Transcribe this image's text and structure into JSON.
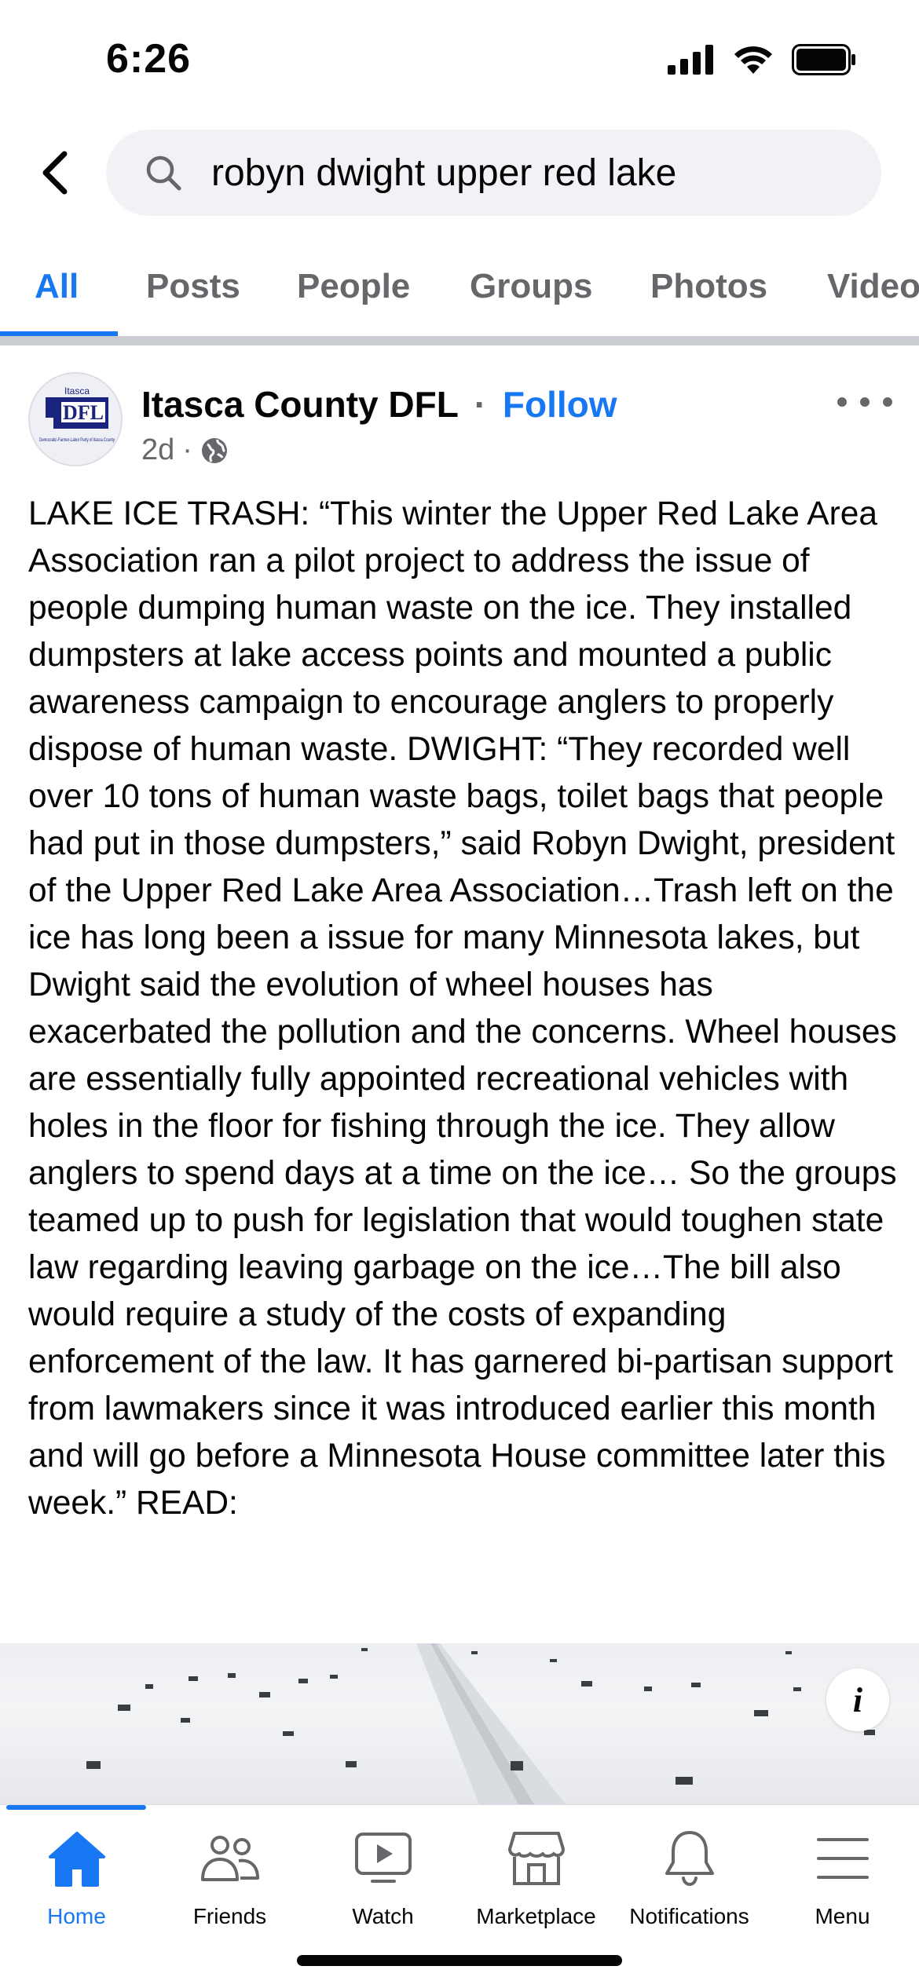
{
  "status_bar": {
    "time": "6:26"
  },
  "search": {
    "query": "robyn dwight upper red lake"
  },
  "tabs": [
    {
      "label": "All",
      "active": true
    },
    {
      "label": "Posts",
      "active": false
    },
    {
      "label": "People",
      "active": false
    },
    {
      "label": "Groups",
      "active": false
    },
    {
      "label": "Photos",
      "active": false
    },
    {
      "label": "Videos",
      "active": false
    }
  ],
  "post": {
    "author": "Itasca County DFL",
    "separator": "·",
    "follow_label": "Follow",
    "time_ago": "2d",
    "meta_separator": "·",
    "avatar_text": {
      "top": "Itasca",
      "logo": "DFL",
      "caption": "Democratic-Farmer-Labor Party of Itasca County"
    },
    "body": "LAKE ICE TRASH: “This winter the Upper Red Lake Area Association ran a pilot project to address the issue of people dumping human waste on the ice. They installed dumpsters at lake access points and mounted a public awareness campaign to encourage anglers to properly dispose of human waste. DWIGHT: “They recorded well over 10 tons of human waste bags, toilet bags that people had put in those dumpsters,” said Robyn Dwight, president of the Upper Red Lake Area Association…Trash left on the ice has long been a issue for many Minnesota lakes, but Dwight said the evolution of wheel houses has exacerbated the pollution and the concerns. Wheel houses are essentially fully appointed recreational vehicles with holes in the floor for fishing through the ice. They allow anglers to spend days at a time on the ice… So the groups teamed up to push for legislation that would toughen state law regarding leaving garbage on the ice…The bill also would require a study of the costs of expanding enforcement of the law. It has garnered bi-partisan support from lawmakers since it was introduced earlier this month and will go before a Minnesota House committee later this week.” READ:",
    "info_glyph": "i"
  },
  "bottom_nav": [
    {
      "label": "Home",
      "icon": "home-icon",
      "active": true
    },
    {
      "label": "Friends",
      "icon": "friends-icon",
      "active": false
    },
    {
      "label": "Watch",
      "icon": "watch-icon",
      "active": false
    },
    {
      "label": "Marketplace",
      "icon": "marketplace-icon",
      "active": false
    },
    {
      "label": "Notifications",
      "icon": "bell-icon",
      "active": false
    },
    {
      "label": "Menu",
      "icon": "menu-icon",
      "active": false
    }
  ],
  "colors": {
    "accent": "#1877f2",
    "secondary_text": "#65676b",
    "search_bg": "#f0f2f5"
  }
}
